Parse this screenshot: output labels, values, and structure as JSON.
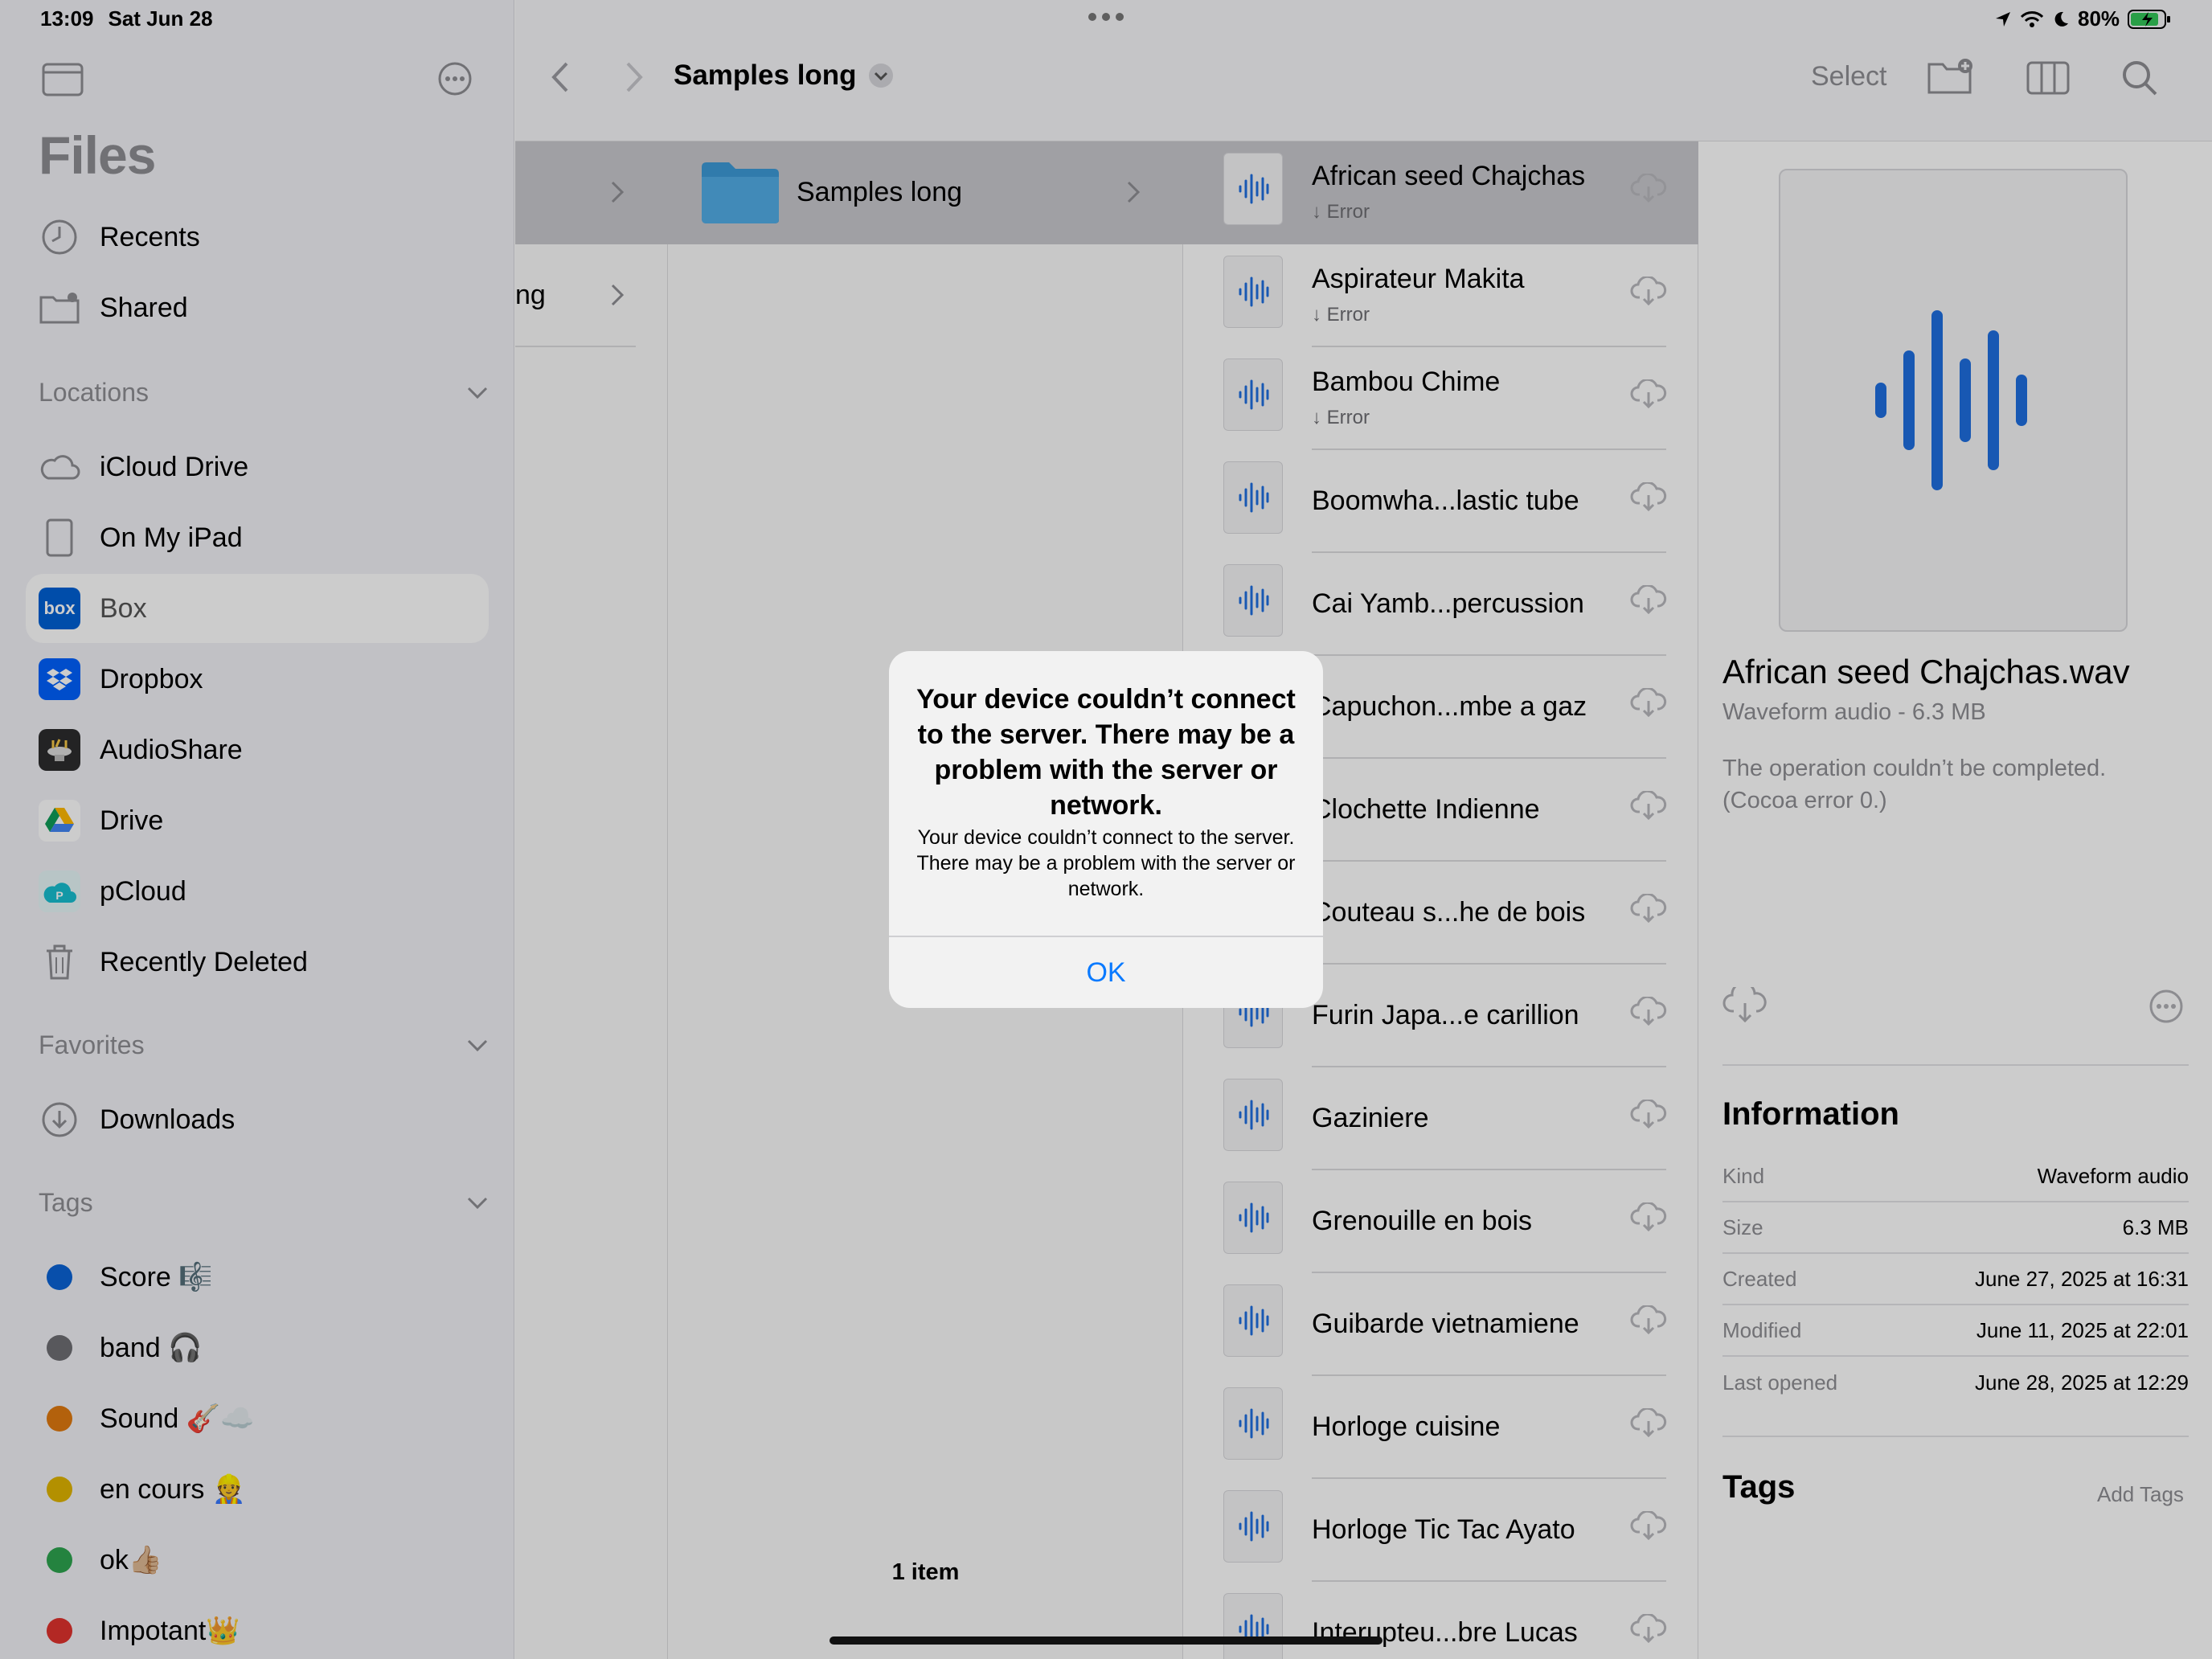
{
  "status": {
    "time": "13:09",
    "date": "Sat Jun 28",
    "battery": "80%"
  },
  "sidebar": {
    "title": "Files",
    "top_items": [
      {
        "label": "Recents"
      },
      {
        "label": "Shared"
      }
    ],
    "locations_label": "Locations",
    "locations": [
      {
        "label": "iCloud Drive"
      },
      {
        "label": "On My iPad"
      },
      {
        "label": "Box",
        "badge": "box"
      },
      {
        "label": "Dropbox"
      },
      {
        "label": "AudioShare"
      },
      {
        "label": "Drive"
      },
      {
        "label": "pCloud"
      },
      {
        "label": "Recently Deleted"
      }
    ],
    "favorites_label": "Favorites",
    "favorites": [
      {
        "label": "Downloads"
      }
    ],
    "tags_label": "Tags",
    "tags": [
      {
        "label": "Score 🎼",
        "color": "#0a63d6"
      },
      {
        "label": "band 🎧",
        "color": "#6e6e73"
      },
      {
        "label": "Sound 🎸☁️",
        "color": "#e07a10"
      },
      {
        "label": "en cours 👷",
        "color": "#e0b400"
      },
      {
        "label": "ok👍🏼",
        "color": "#2ea44f"
      },
      {
        "label": "Impotant👑",
        "color": "#e0322e"
      }
    ]
  },
  "toolbar": {
    "title": "Samples long",
    "select_label": "Select"
  },
  "columns": {
    "col1_partial": "ng",
    "folder_name": "Samples long",
    "item_count": "1 item"
  },
  "files": [
    {
      "name": "African seed Chajchas",
      "status": "↓ Error"
    },
    {
      "name": "Aspirateur Makita",
      "status": "↓ Error"
    },
    {
      "name": "Bambou Chime",
      "status": "↓ Error"
    },
    {
      "name": "Boomwha...lastic tube",
      "status": ""
    },
    {
      "name": "Cai Yamb...percussion",
      "status": ""
    },
    {
      "name": "Capuchon...mbe a gaz",
      "status": ""
    },
    {
      "name": "Clochette Indienne",
      "status": ""
    },
    {
      "name": "Couteau s...he de bois",
      "status": ""
    },
    {
      "name": "Furin Japa...e carillion",
      "status": ""
    },
    {
      "name": "Gaziniere",
      "status": ""
    },
    {
      "name": "Grenouille en bois",
      "status": ""
    },
    {
      "name": "Guibarde vietnamiene",
      "status": ""
    },
    {
      "name": "Horloge cuisine",
      "status": ""
    },
    {
      "name": "Horloge Tic Tac Ayato",
      "status": ""
    },
    {
      "name": "Interupteu...bre Lucas",
      "status": ""
    }
  ],
  "detail": {
    "title": "African seed Chajchas.wav",
    "subtitle": "Waveform audio - 6.3 MB",
    "error": "The operation couldn’t be completed. (Cocoa error 0.)",
    "info_heading": "Information",
    "info": [
      {
        "key": "Kind",
        "value": "Waveform audio"
      },
      {
        "key": "Size",
        "value": "6.3 MB"
      },
      {
        "key": "Created",
        "value": "June 27, 2025 at 16:31"
      },
      {
        "key": "Modified",
        "value": "June 11, 2025 at 22:01"
      },
      {
        "key": "Last opened",
        "value": "June 28, 2025 at 12:29"
      }
    ],
    "tags_heading": "Tags",
    "add_tags": "Add Tags"
  },
  "alert": {
    "title": "Your device couldn’t connect to the server. There may be a problem with the server or network.",
    "message": "Your device couldn’t connect to the server. There may be a problem with the server or network.",
    "ok_label": "OK"
  },
  "colors": {
    "accent": "#0a7aff",
    "waveform": "#1f6fe0",
    "folder": "#3d9ad8"
  }
}
